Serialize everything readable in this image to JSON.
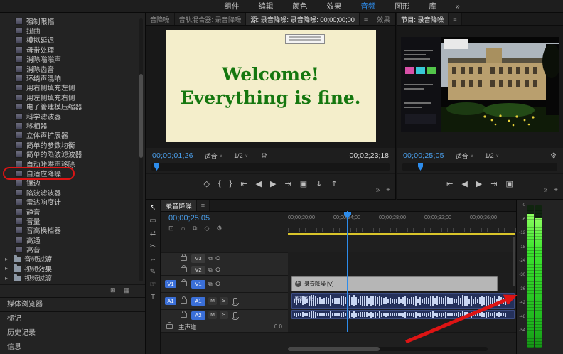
{
  "topbar": {
    "tabs": [
      {
        "label": "组件"
      },
      {
        "label": "编辑"
      },
      {
        "label": "颜色"
      },
      {
        "label": "效果"
      },
      {
        "label": "音频",
        "active": true
      },
      {
        "label": "图形"
      },
      {
        "label": "库"
      },
      {
        "label": "»",
        "name": "workspace-overflow-icon"
      }
    ]
  },
  "glyphs": {
    "menu": "≡",
    "more": "»",
    "add": "+",
    "caret": "∨",
    "chevron": "▸",
    "sync": "⧉",
    "eye": "⊙",
    "wrench": "⚙"
  },
  "effects": {
    "items": [
      "强制限幅",
      "扭曲",
      "模拟延迟",
      "母带处理",
      "消除嗡嗡声",
      "消除齿音",
      "环绕声混响",
      "用右侧填充左侧",
      "用左侧填充右侧",
      "电子管建模压缩器",
      "科学滤波器",
      "移相器",
      "立体声扩展器",
      "简单的参数均衡",
      "简单的陷波滤波器",
      "自动咔嗒声移除",
      "自适应降噪",
      "镶边",
      "陷波滤波器",
      "雷达响度计",
      "静音",
      "音量",
      "音高换挡器",
      "高通",
      "高音"
    ],
    "highlighted_item": "自适应降噪",
    "folders": [
      "音频过渡",
      "视频效果",
      "视频过渡"
    ],
    "bottom_icons": [
      {
        "name": "new-custom-bin-icon",
        "glyph": "⊞"
      },
      {
        "name": "delete-icon",
        "glyph": "▦"
      }
    ],
    "panel_tabs": [
      "媒体浏览器",
      "标记",
      "历史记录",
      "信息"
    ]
  },
  "source": {
    "tabs": [
      {
        "label": "音降噪"
      },
      {
        "label": "音轨混合器: 录音降噪"
      },
      {
        "label": "源: 录音降噪: 录音降噪: 00;00;00;00",
        "active": true
      },
      {
        "label": "≡",
        "name": "panel-menu-icon"
      },
      {
        "label": "效果"
      }
    ],
    "slate_line1": "Welcome!",
    "slate_line2": "Everything is fine.",
    "time": "00;00;01;26",
    "fit": "适合",
    "zoom": "1/2",
    "duration": "00;02;23;18",
    "transport": [
      {
        "name": "add-marker-icon",
        "glyph": "◇"
      },
      {
        "name": "mark-in-icon",
        "glyph": "{"
      },
      {
        "name": "mark-out-icon",
        "glyph": "}"
      },
      {
        "name": "go-to-in-icon",
        "glyph": "⇤"
      },
      {
        "name": "step-back-icon",
        "glyph": "◀"
      },
      {
        "name": "play-icon",
        "glyph": "▶"
      },
      {
        "name": "go-to-out-icon",
        "glyph": "⇥"
      },
      {
        "name": "export-frame-icon",
        "glyph": "▣"
      },
      {
        "name": "insert-icon",
        "glyph": "↧"
      },
      {
        "name": "overwrite-icon",
        "glyph": "↥"
      }
    ]
  },
  "program": {
    "tabs": [
      {
        "label": "节目: 录音降噪",
        "active": true
      },
      {
        "label": "≡",
        "name": "panel-menu-icon"
      }
    ],
    "time": "00;00;25;05",
    "fit": "适合",
    "zoom": "1/2",
    "transport": [
      {
        "name": "go-to-in-icon",
        "glyph": "⇤"
      },
      {
        "name": "step-back-icon",
        "glyph": "◀"
      },
      {
        "name": "play-icon",
        "glyph": "▶"
      },
      {
        "name": "go-to-out-icon",
        "glyph": "⇥"
      },
      {
        "name": "export-frame-icon",
        "glyph": "▣"
      }
    ]
  },
  "tools": [
    {
      "name": "selection-tool-icon",
      "glyph": "↖",
      "active": true
    },
    {
      "name": "track-select-tool-icon",
      "glyph": "▭"
    },
    {
      "name": "ripple-edit-tool-icon",
      "glyph": "⇄"
    },
    {
      "name": "razor-tool-icon",
      "glyph": "✂"
    },
    {
      "name": "slip-tool-icon",
      "glyph": "↔"
    },
    {
      "name": "pen-tool-icon",
      "glyph": "✎"
    },
    {
      "name": "hand-tool-icon",
      "glyph": "☞"
    },
    {
      "name": "type-tool-icon",
      "glyph": "T"
    }
  ],
  "timeline": {
    "tabs": [
      {
        "label": "录音降噪",
        "active": true
      },
      {
        "label": "≡",
        "name": "panel-menu-icon"
      }
    ],
    "time": "00;00;25;05",
    "toolbar": [
      {
        "name": "nest-icon",
        "glyph": "⊡"
      },
      {
        "name": "snap-icon",
        "glyph": "∩"
      },
      {
        "name": "linked-selection-icon",
        "glyph": "⧉"
      },
      {
        "name": "add-marker-icon",
        "glyph": "◇"
      },
      {
        "name": "settings-icon",
        "glyph": "⚙"
      }
    ],
    "ruler": [
      "00;00;20;00",
      "00;00;24;00",
      "00;00;28;00",
      "00;00;32;00",
      "00;00;36;00"
    ],
    "tracks": {
      "v3": "V3",
      "v2": "V2",
      "v1": "V1",
      "a1": "A1",
      "a2": "A2",
      "mute": "M",
      "solo": "S",
      "master_label": "主声道",
      "master_value": "0.0"
    },
    "clips": {
      "video_label": "录音降噪 [V]",
      "audio_label": "录音降噪",
      "fx_badge": "fx"
    }
  },
  "meter": {
    "labels": [
      "0",
      "-6",
      "-12",
      "-18",
      "-24",
      "-30",
      "-36",
      "-42",
      "-48",
      "-54"
    ]
  },
  "colors": {
    "accent_blue": "#2d8ceb",
    "timecode_blue": "#4a9eea",
    "render_bar_yellow": "#d9c42b",
    "slate_bg": "#f4eecb",
    "slate_text": "#15770f",
    "meter_green": "#35e02c",
    "annotation_red": "#dd1414",
    "track_target_blue": "#3a6fd8"
  }
}
